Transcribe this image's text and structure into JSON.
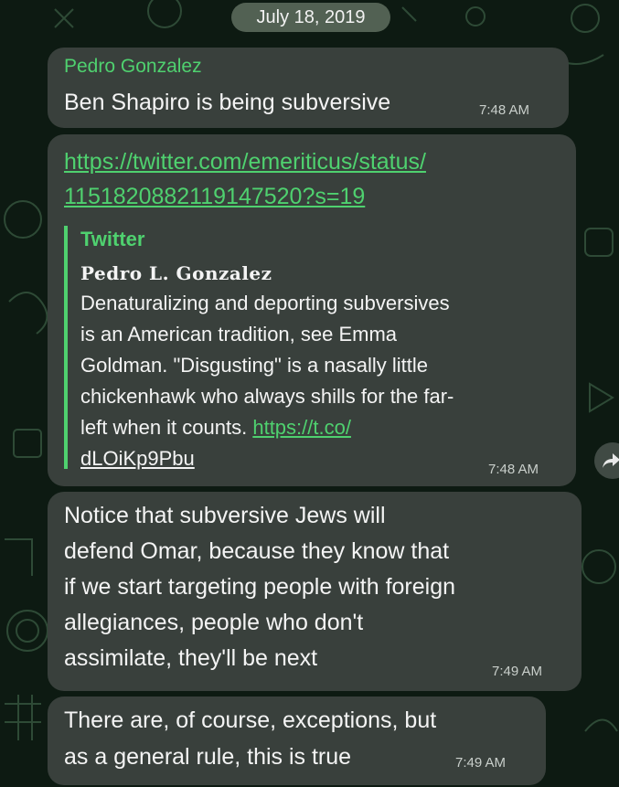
{
  "date_label": "July 18, 2019",
  "messages": [
    {
      "sender": "Pedro Gonzalez",
      "text": "Ben Shapiro is being subversive",
      "time": "7:48 AM"
    },
    {
      "link_lines": [
        "https://twitter.com/emeriticus/status/",
        "1151820882119147520?s=19"
      ],
      "preview": {
        "source": "Twitter",
        "author": "Pedro L. Gonzalez",
        "lines": [
          "Denaturalizing and deporting subversives",
          "is an American tradition, see Emma",
          "Goldman. \"Disgusting\" is a nasally little",
          "chickenhawk who always shills for the far-",
          "left when it counts."
        ],
        "inline_link": "https://t.co/",
        "last_link": "dLOiKp9Pbu"
      },
      "time": "7:48 AM"
    },
    {
      "lines": [
        "Notice that subversive Jews will",
        "defend Omar, because they know that",
        "if we start targeting people with foreign",
        "allegiances, people who don't",
        "assimilate, they'll be next"
      ],
      "time": "7:49 AM"
    },
    {
      "lines": [
        "There are, of course, exceptions, but",
        "as a general rule, this is true"
      ],
      "time": "7:49 AM"
    }
  ],
  "icons": {
    "share": "share-icon",
    "background": "doodle-pattern"
  },
  "colors": {
    "background": "#0d1a12",
    "bubble": "#39403c",
    "accent": "#4fd16f",
    "text": "#f4f4f4"
  }
}
